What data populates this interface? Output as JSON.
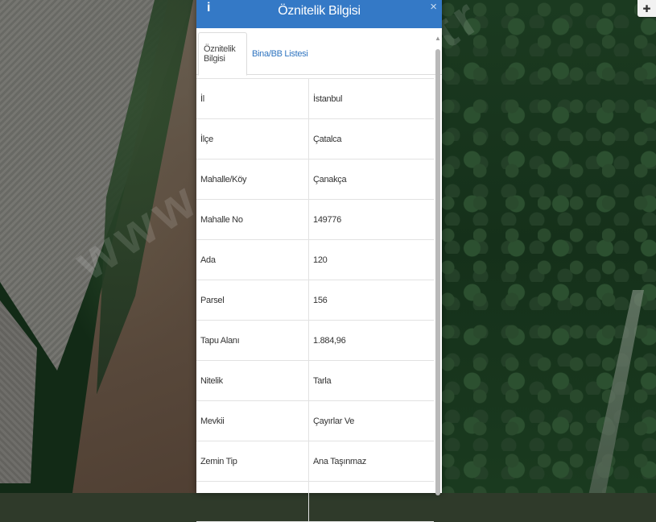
{
  "panel": {
    "title": "Öznitelik Bilgisi",
    "info_icon": "info-icon",
    "close_icon": "close-icon",
    "close_glyph": "×",
    "info_glyph": "i"
  },
  "tabs": [
    {
      "label": "Öznitelik Bilgisi",
      "active": true
    },
    {
      "label": "Bina/BB Listesi",
      "active": false
    }
  ],
  "attributes": [
    {
      "key": "İl",
      "value": "İstanbul"
    },
    {
      "key": "İlçe",
      "value": "Çatalca"
    },
    {
      "key": "Mahalle/Köy",
      "value": "Çanakça"
    },
    {
      "key": "Mahalle No",
      "value": "149776"
    },
    {
      "key": "Ada",
      "value": "120"
    },
    {
      "key": "Parsel",
      "value": "156"
    },
    {
      "key": "Tapu Alanı",
      "value": "1.884,96"
    },
    {
      "key": "Nitelik",
      "value": "Tarla"
    },
    {
      "key": "Mevkii",
      "value": "Çayırlar Ve"
    },
    {
      "key": "Zemin Tip",
      "value": "Ana Taşınmaz"
    },
    {
      "key": "",
      "value": ""
    }
  ],
  "watermark": "www.ja...e.net.tr",
  "map_control_icon": "layers-icon",
  "colors": {
    "header": "#3479c6",
    "link": "#2f74c0"
  }
}
